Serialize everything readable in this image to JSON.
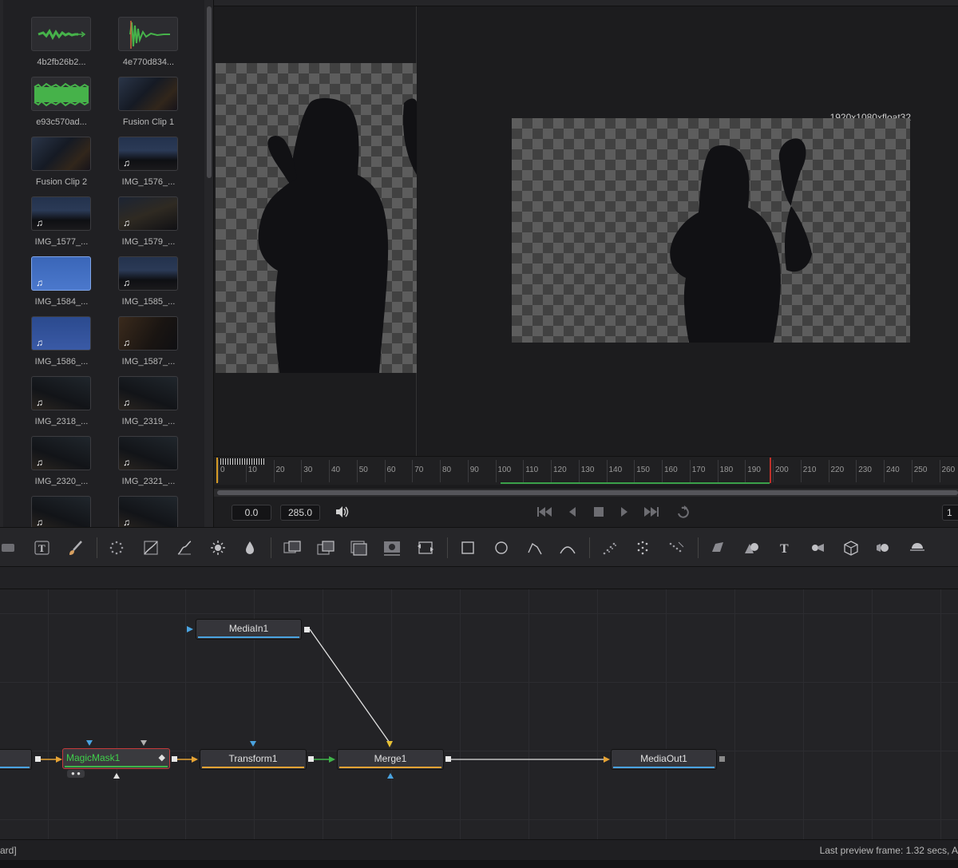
{
  "media_pool": {
    "clips": [
      {
        "name": "4b2fb26b2...",
        "kind": "audio"
      },
      {
        "name": "4e770d834...",
        "kind": "audio"
      },
      {
        "name": "e93c570ad...",
        "kind": "audio"
      },
      {
        "name": "Fusion Clip 1",
        "kind": "video"
      },
      {
        "name": "Fusion Clip 2",
        "kind": "video"
      },
      {
        "name": "IMG_1576_...",
        "kind": "video"
      },
      {
        "name": "IMG_1577_...",
        "kind": "video"
      },
      {
        "name": "IMG_1579_...",
        "kind": "video"
      },
      {
        "name": "IMG_1584_...",
        "kind": "video"
      },
      {
        "name": "IMG_1585_...",
        "kind": "video"
      },
      {
        "name": "IMG_1586_...",
        "kind": "video"
      },
      {
        "name": "IMG_1587_...",
        "kind": "video"
      },
      {
        "name": "IMG_2318_...",
        "kind": "video"
      },
      {
        "name": "IMG_2319_...",
        "kind": "video"
      },
      {
        "name": "IMG_2320_...",
        "kind": "video"
      },
      {
        "name": "IMG_2321_...",
        "kind": "video"
      },
      {
        "name": "",
        "kind": "video"
      },
      {
        "name": "",
        "kind": "video"
      }
    ],
    "music_icon": "♫"
  },
  "viewer": {
    "resolution_label": "1920x1080xfloat32"
  },
  "timeline": {
    "ticks": [
      "0",
      "10",
      "20",
      "30",
      "40",
      "50",
      "60",
      "70",
      "80",
      "90",
      "100",
      "110",
      "120",
      "130",
      "140",
      "150",
      "160",
      "170",
      "180",
      "190",
      "200",
      "210",
      "220",
      "230",
      "240",
      "250",
      "260"
    ],
    "current_frame": 195,
    "render_range": [
      100,
      195
    ]
  },
  "transport": {
    "start_value": "0.0",
    "end_value": "285.0",
    "right_value": "1",
    "buttons": [
      "skip-to-start",
      "step-back",
      "stop",
      "play",
      "skip-to-end",
      "loop"
    ]
  },
  "toolbar": {
    "tools": [
      "background-icon",
      "text-icon",
      "paint-icon",
      "particles-icon",
      "color-curves-icon",
      "color-corrector-icon",
      "brightness-icon",
      "blur-icon",
      "merge-icon",
      "dissolve-icon",
      "channel-booleans-icon",
      "matte-control-icon",
      "loader-saver-icon",
      "rectangle-mask-icon",
      "ellipse-mask-icon",
      "polygon-mask-icon",
      "bspline-mask-icon",
      "p-emitter-icon",
      "p-render-icon",
      "p-kill-icon",
      "shape3d-icon",
      "merge3d-icon",
      "text3d-icon",
      "camera3d-icon",
      "renderer3d-icon",
      "image-plane-icon",
      "light-icon"
    ]
  },
  "nodes": {
    "media_in": "MediaIn1",
    "magic_mask": "MagicMask1",
    "transform": "Transform1",
    "merge": "Merge1",
    "media_out": "MediaOut1"
  },
  "status": {
    "left_text": "ard]",
    "right_text": "Last preview frame: 1.32 secs, A"
  },
  "colors": {
    "accent_red": "#c0312b",
    "playhead_orange": "#d49a25",
    "range_green": "#3aa04a",
    "node_blue": "#4aa3e0",
    "node_orange": "#e6a334",
    "node_green": "#3fb34a",
    "mask_text_green": "#3fd14a",
    "audio_wave_green": "#46b24a"
  }
}
